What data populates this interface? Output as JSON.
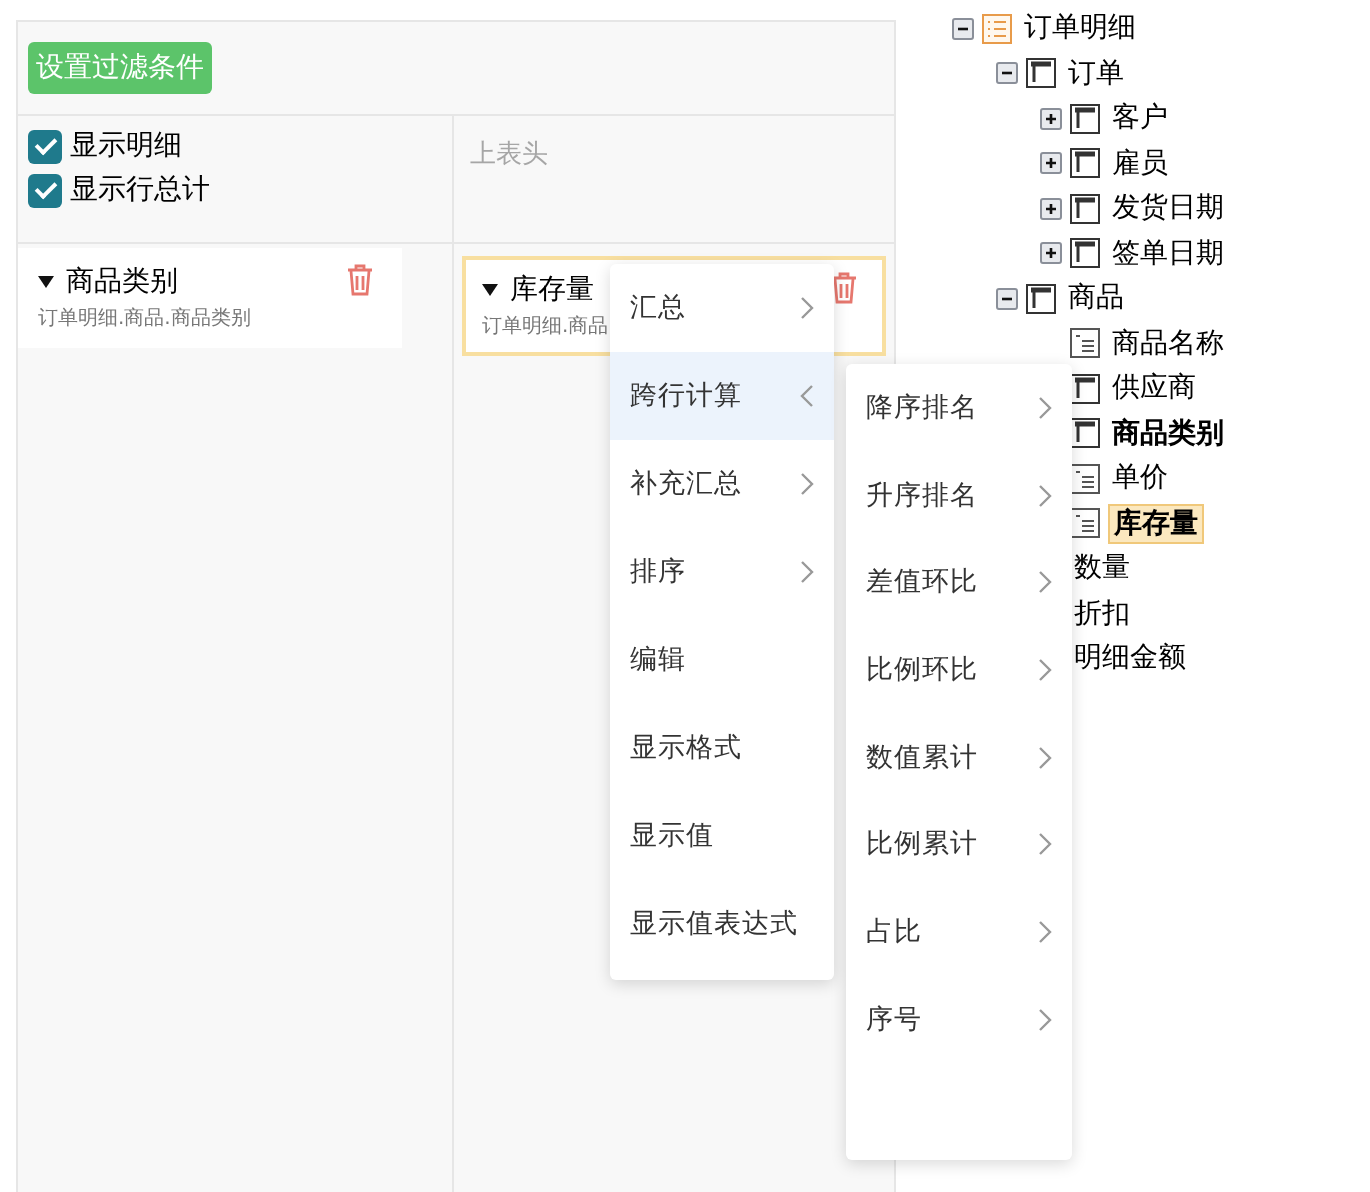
{
  "filter_button": "设置过滤条件",
  "options": [
    {
      "label": "显示明细",
      "checked": true
    },
    {
      "label": "显示行总计",
      "checked": true
    }
  ],
  "top_header_placeholder": "上表头",
  "row_fields": [
    {
      "name": "商品类别",
      "path": "订单明细.商品.商品类别",
      "selected": false
    }
  ],
  "value_fields": [
    {
      "name": "库存量",
      "path": "订单明细.商品",
      "selected": true
    }
  ],
  "context_menu": [
    {
      "label": "汇总",
      "submenu": true,
      "open": false
    },
    {
      "label": "跨行计算",
      "submenu": true,
      "open": true
    },
    {
      "label": "补充汇总",
      "submenu": true,
      "open": false
    },
    {
      "label": "排序",
      "submenu": true,
      "open": false
    },
    {
      "label": "编辑",
      "submenu": false,
      "open": false
    },
    {
      "label": "显示格式",
      "submenu": false,
      "open": false
    },
    {
      "label": "显示值",
      "submenu": false,
      "open": false
    },
    {
      "label": "显示值表达式",
      "submenu": false,
      "open": false
    }
  ],
  "submenu": [
    {
      "label": "降序排名",
      "submenu": true
    },
    {
      "label": "升序排名",
      "submenu": true
    },
    {
      "label": "差值环比",
      "submenu": true
    },
    {
      "label": "比例环比",
      "submenu": true
    },
    {
      "label": "数值累计",
      "submenu": true
    },
    {
      "label": "比例累计",
      "submenu": true
    },
    {
      "label": "占比",
      "submenu": true
    },
    {
      "label": "序号",
      "submenu": true
    }
  ],
  "tree": [
    {
      "label": "订单明细",
      "kind": "root",
      "expanded": true,
      "bold": false,
      "selected": false,
      "children": [
        {
          "label": "订单",
          "kind": "table",
          "expanded": true,
          "bold": false,
          "selected": false,
          "children": [
            {
              "label": "客户",
              "kind": "table",
              "expanded": false,
              "bold": false,
              "selected": false
            },
            {
              "label": "雇员",
              "kind": "table",
              "expanded": false,
              "bold": false,
              "selected": false
            },
            {
              "label": "发货日期",
              "kind": "table",
              "expanded": false,
              "bold": false,
              "selected": false
            },
            {
              "label": "签单日期",
              "kind": "table",
              "expanded": false,
              "bold": false,
              "selected": false
            }
          ]
        },
        {
          "label": "商品",
          "kind": "table",
          "expanded": true,
          "bold": false,
          "selected": false,
          "children": [
            {
              "label": "商品名称",
              "kind": "field",
              "bold": false,
              "selected": false
            },
            {
              "label": "供应商",
              "kind": "table",
              "bold": false,
              "selected": false
            },
            {
              "label": "商品类别",
              "kind": "table",
              "bold": true,
              "selected": false
            },
            {
              "label": "单价",
              "kind": "field",
              "bold": false,
              "selected": false
            },
            {
              "label": "库存量",
              "kind": "field",
              "bold": true,
              "selected": true
            },
            {
              "label": "数量",
              "kind": "plain",
              "bold": false,
              "selected": false
            },
            {
              "label": "折扣",
              "kind": "plain",
              "bold": false,
              "selected": false
            },
            {
              "label": "明细金额",
              "kind": "plain",
              "bold": false,
              "selected": false
            }
          ]
        }
      ]
    }
  ]
}
